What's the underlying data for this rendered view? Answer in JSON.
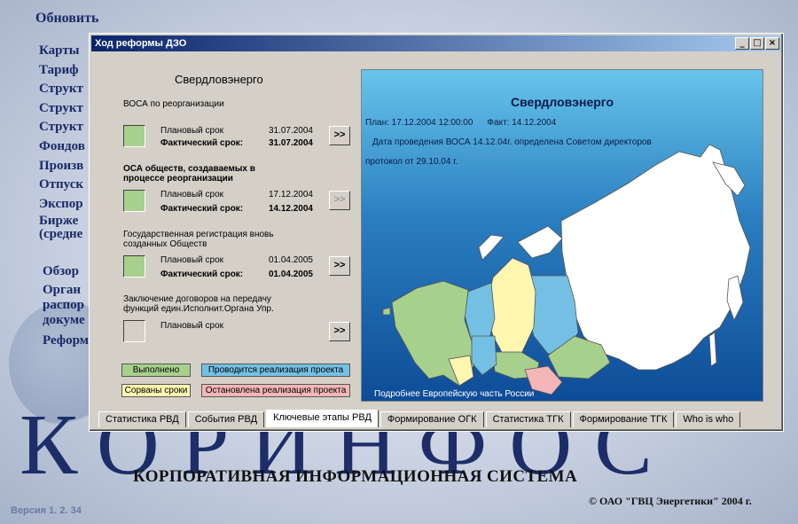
{
  "background": {
    "refresh": "Обновить",
    "menu_top": [
      "Карты",
      "Тариф",
      "Структ",
      "Структ",
      "Структ",
      "Фондов",
      "Произв",
      "Отпуск",
      "Экспор",
      "Бирже",
      "(средне"
    ],
    "menu_bottom": [
      "Обзор",
      "Орган",
      "распор",
      "докуме",
      "Реформ"
    ],
    "brand": "КОРИНФОС",
    "subtitle": "КОРПОРАТИВНАЯ ИНФОРМАЦИОННАЯ СИСТЕМА",
    "version": "Версия  1. 2. 34",
    "copyright": "© ОАО \"ГВЦ Энергетики\" 2004 г."
  },
  "window": {
    "title": "Ход реформы ДЗО",
    "buttons": {
      "minimize": "_",
      "maximize": "□",
      "close": "×"
    }
  },
  "left": {
    "company": "Свердловэнерго",
    "items": [
      {
        "title": "ВОСА по реорганизации",
        "plan_label": "Плановый срок",
        "plan_value": "31.07.2004",
        "fact_label": "Фактический срок:",
        "fact_value": "31.07.2004",
        "button": ">>"
      },
      {
        "title_line1": "ОСА обществ, создаваемых в",
        "title_line2": "процессе реорганизации",
        "plan_label": "Плановый срок",
        "plan_value": "17.12.2004",
        "fact_label": "Фактический срок:",
        "fact_value": "14.12.2004",
        "button": ">>"
      },
      {
        "title_line1": "Государственная регистрация вновь",
        "title_line2": "созданных Обществ",
        "plan_label": "Плановый срок",
        "plan_value": "01.04.2005",
        "fact_label": "Фактический срок:",
        "fact_value": "01.04.2005",
        "button": ">>"
      },
      {
        "title_line1": "Заключение договоров на передачу",
        "title_line2": "функций един.Исполнит.Органа Упр.",
        "plan_label": "Плановый срок",
        "button": ">>"
      }
    ],
    "legend": {
      "done": "Выполнено",
      "in_progress": "Проводится реализация проекта",
      "overdue": "Сорваны сроки",
      "stopped": "Остановлена реализация проекта"
    },
    "colors": {
      "done": "#a8d08d",
      "in_progress": "#74c0e4",
      "overdue": "#fff6b0",
      "stopped": "#f4b6b6"
    }
  },
  "map": {
    "title": "Свердловэнерго",
    "plan": "План: 17.12.2004 12:00:00",
    "fact": "Факт: 14.12.2004",
    "line2": "Дата проведения ВОСА 14.12.04г. определена Советом директоров",
    "line3": "протокол от 29.10.04 г.",
    "link": "Подробнее Европейскую часть России"
  },
  "tabs": [
    "Статистика РВД",
    "События РВД",
    "Ключевые этапы РВД",
    "Формирование ОГК",
    "Статистика ТГК",
    "Формирование ТГК",
    "Who is who"
  ],
  "active_tab": "Ключевые этапы РВД"
}
